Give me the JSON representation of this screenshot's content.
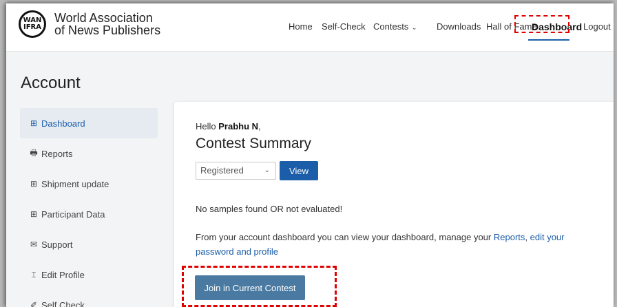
{
  "brand": {
    "logo_line1": "WAN",
    "logo_line2": "IFRA",
    "name_line1": "World Association",
    "name_line2": "of News Publishers"
  },
  "nav": {
    "items": [
      "Home",
      "Self-Check",
      "Contests",
      "Downloads",
      "Hall of Fame",
      "Dashboard",
      "Logout"
    ],
    "contests_chevron": "⌄",
    "active": "Dashboard"
  },
  "page": {
    "title": "Account"
  },
  "sidebar": {
    "items": [
      {
        "icon": "⊞",
        "label": "Dashboard",
        "active": true
      },
      {
        "icon": "🖶",
        "label": "Reports"
      },
      {
        "icon": "⊞",
        "label": "Shipment update"
      },
      {
        "icon": "⊞",
        "label": "Participant Data"
      },
      {
        "icon": "✉",
        "label": "Support"
      },
      {
        "icon": "⌶",
        "label": "Edit Profile"
      },
      {
        "icon": "✐",
        "label": "Self Check"
      }
    ]
  },
  "main": {
    "greeting_prefix": "Hello ",
    "user_name": "Prabhu N",
    "greeting_suffix": ",",
    "summary_title": "Contest Summary",
    "status_select": {
      "value": "Registered",
      "caret": "⌄"
    },
    "view_label": "View",
    "no_samples": "No samples found OR not evaluated!",
    "desc_part1": "From your account dashboard you can view your dashboard, manage your ",
    "desc_reports": "Reports",
    "desc_sep": ", ",
    "desc_edit": "edit your password and profile",
    "join_label": "Join in Current Contest"
  },
  "colors": {
    "accent": "#1b5da8",
    "join_button": "#4a7aa1",
    "highlight": "#e00000"
  }
}
